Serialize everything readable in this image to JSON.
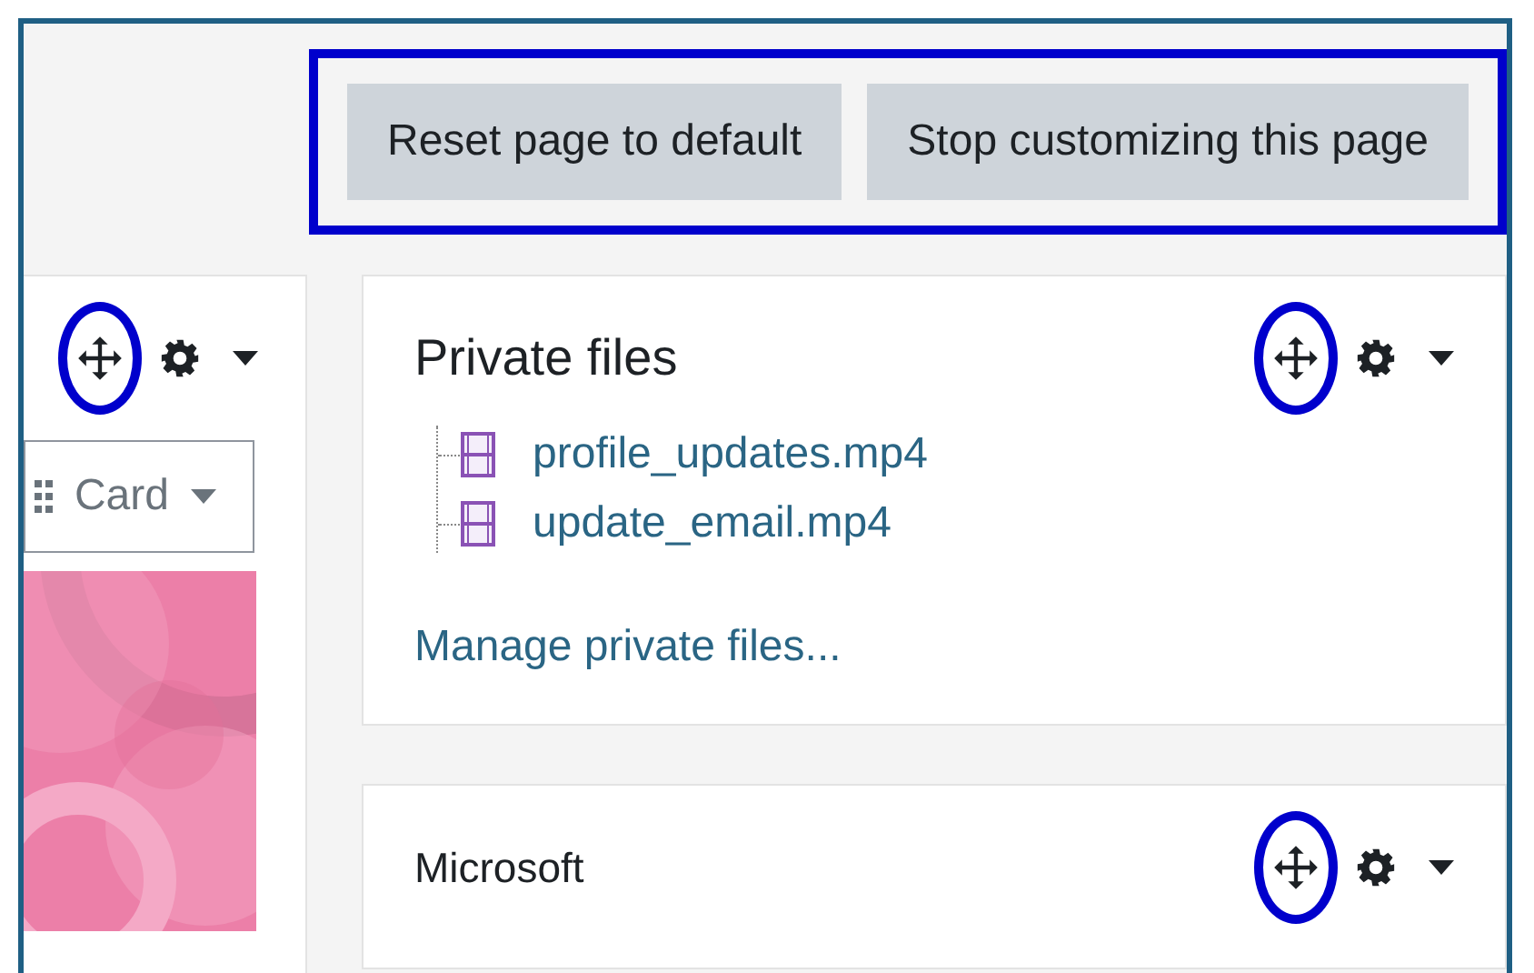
{
  "toolbar": {
    "highlighted": true,
    "buttons": [
      {
        "label": "Reset page to default"
      },
      {
        "label": "Stop customizing this page"
      }
    ]
  },
  "left_block": {
    "move_highlighted": true,
    "view_select": {
      "value": "Card"
    }
  },
  "blocks": [
    {
      "title": "Private files",
      "move_highlighted": true,
      "files": [
        {
          "name": "profile_updates.mp4"
        },
        {
          "name": "update_email.mp4"
        }
      ],
      "link": "Manage private files..."
    },
    {
      "title": "Microsoft",
      "move_highlighted": true
    }
  ]
}
